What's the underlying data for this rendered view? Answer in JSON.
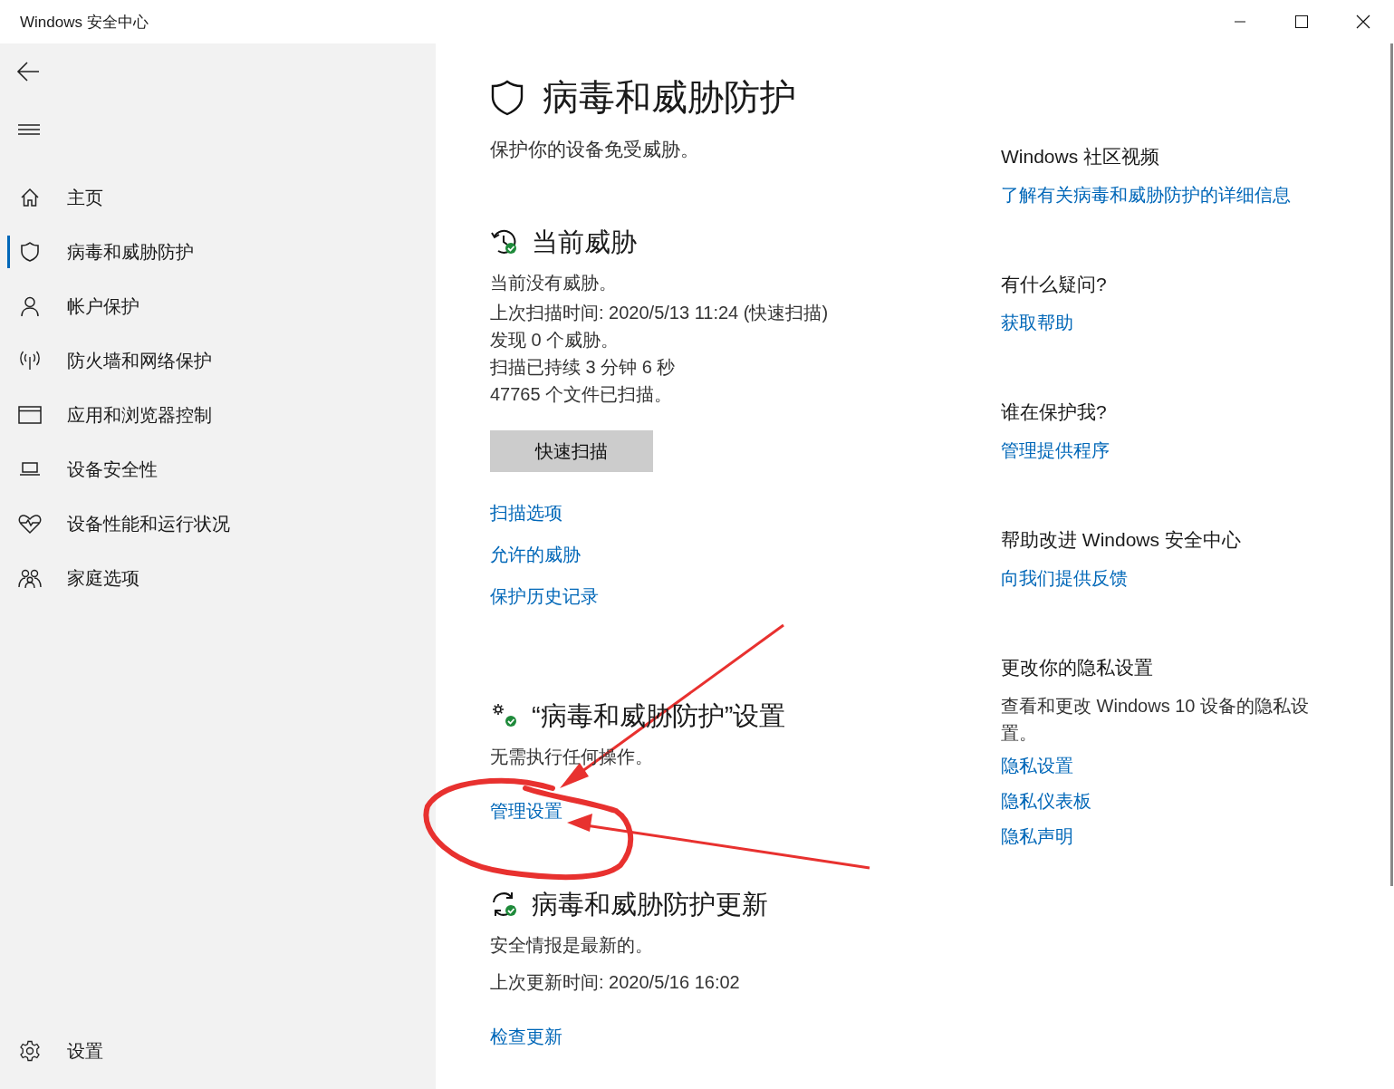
{
  "window": {
    "title": "Windows 安全中心"
  },
  "sidebar": {
    "items": [
      {
        "label": "主页",
        "selected": false
      },
      {
        "label": "病毒和威胁防护",
        "selected": true
      },
      {
        "label": "帐户保护",
        "selected": false
      },
      {
        "label": "防火墙和网络保护",
        "selected": false
      },
      {
        "label": "应用和浏览器控制",
        "selected": false
      },
      {
        "label": "设备安全性",
        "selected": false
      },
      {
        "label": "设备性能和运行状况",
        "selected": false
      },
      {
        "label": "家庭选项",
        "selected": false
      }
    ],
    "settings": {
      "label": "设置"
    }
  },
  "page": {
    "title": "病毒和威胁防护",
    "subtitle": "保护你的设备免受威胁。"
  },
  "threats": {
    "heading": "当前威胁",
    "status": "当前没有威胁。",
    "details": [
      "上次扫描时间: 2020/5/13 11:24 (快速扫描)",
      "发现 0 个威胁。",
      "扫描已持续 3 分钟 6 秒",
      "47765 个文件已扫描。"
    ],
    "button": "快速扫描",
    "links": [
      "扫描选项",
      "允许的威胁",
      "保护历史记录"
    ]
  },
  "protection_settings": {
    "heading": "“病毒和威胁防护”设置",
    "status": "无需执行任何操作。",
    "link": "管理设置"
  },
  "updates": {
    "heading": "病毒和威胁防护更新",
    "status": "安全情报是最新的。",
    "last_update": "上次更新时间: 2020/5/16 16:02",
    "link": "检查更新"
  },
  "side_panel": [
    {
      "heading": "Windows 社区视频",
      "links": [
        "了解有关病毒和威胁防护的详细信息"
      ]
    },
    {
      "heading": "有什么疑问?",
      "links": [
        "获取帮助"
      ]
    },
    {
      "heading": "谁在保护我?",
      "links": [
        "管理提供程序"
      ]
    },
    {
      "heading": "帮助改进 Windows 安全中心",
      "links": [
        "向我们提供反馈"
      ]
    },
    {
      "heading": "更改你的隐私设置",
      "text": "查看和更改 Windows 10 设备的隐私设置。",
      "links": [
        "隐私设置",
        "隐私仪表板",
        "隐私声明"
      ]
    }
  ]
}
